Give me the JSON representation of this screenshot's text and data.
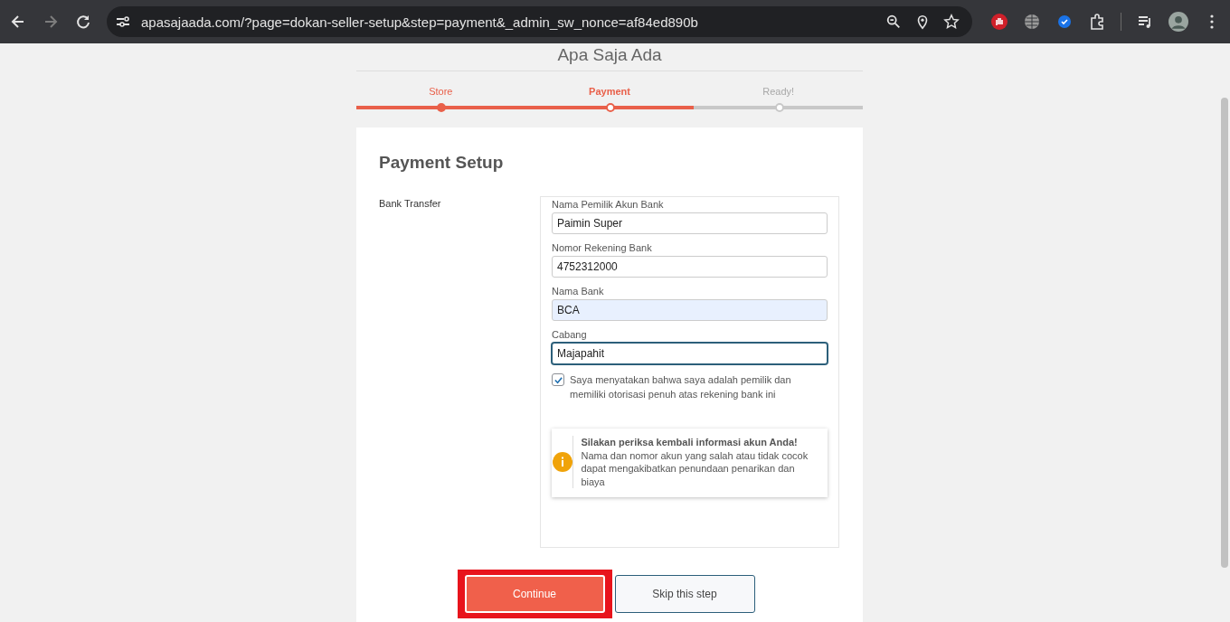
{
  "browser": {
    "url": "apasajaada.com/?page=dokan-seller-setup&step=payment&_admin_sw_nonce=af84ed890b",
    "forward_disabled": true
  },
  "site_title": "Apa Saja Ada",
  "steps": [
    {
      "label": "Store",
      "completed": true,
      "selected": false
    },
    {
      "label": "Payment",
      "completed": false,
      "selected": true
    },
    {
      "label": "Ready!",
      "completed": false,
      "selected": false
    }
  ],
  "heading": "Payment Setup",
  "section_label": "Bank Transfer",
  "fields": [
    {
      "label": "Nama Pemilik Akun Bank",
      "value": "Paimin Super",
      "autofilled": false,
      "focused": false
    },
    {
      "label": "Nomor Rekening Bank",
      "value": "4752312000",
      "autofilled": false,
      "focused": false
    },
    {
      "label": "Nama Bank",
      "value": "BCA",
      "autofilled": true,
      "focused": false
    },
    {
      "label": "Cabang",
      "value": "Majapahit",
      "autofilled": false,
      "focused": true
    }
  ],
  "declaration": {
    "text": "Saya menyatakan bahwa saya adalah pemilik dan memiliki otorisasi penuh atas rekening bank ini",
    "checked": true
  },
  "notice": {
    "title": "Silakan periksa kembali informasi akun Anda!",
    "body": "Nama dan nomor akun yang salah atau tidak cocok dapat mengakibatkan penundaan penarikan dan biaya"
  },
  "buttons": [
    {
      "label": "Continue",
      "kind": "primary",
      "highlighted": true
    },
    {
      "label": "Skip this step",
      "kind": "secondary",
      "highlighted": false
    }
  ]
}
